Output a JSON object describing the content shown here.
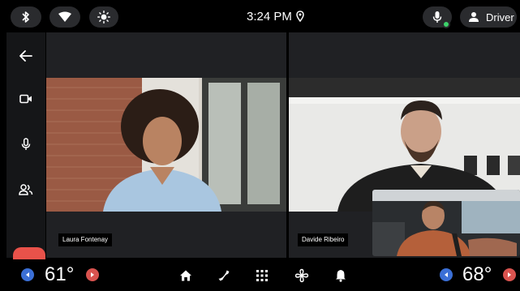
{
  "status": {
    "time": "3:24 PM",
    "user_label": "Driver",
    "mic_status_color": "#3dd26b"
  },
  "left_rail": {
    "items": [
      "back-icon",
      "camera-icon",
      "microphone-icon",
      "participants-icon"
    ],
    "end_call_color": "#e9524a"
  },
  "participants": [
    {
      "name": "Laura Fontenay"
    },
    {
      "name": "Davide Ribeiro"
    }
  ],
  "climate": {
    "left_temp": "61°",
    "right_temp": "68°",
    "decrease_color": "#3b6fd6",
    "increase_color": "#d9534f"
  },
  "dock": {
    "items": [
      "home-icon",
      "phone-icon",
      "apps-grid-icon",
      "fan-icon",
      "notification-bell-icon"
    ]
  }
}
